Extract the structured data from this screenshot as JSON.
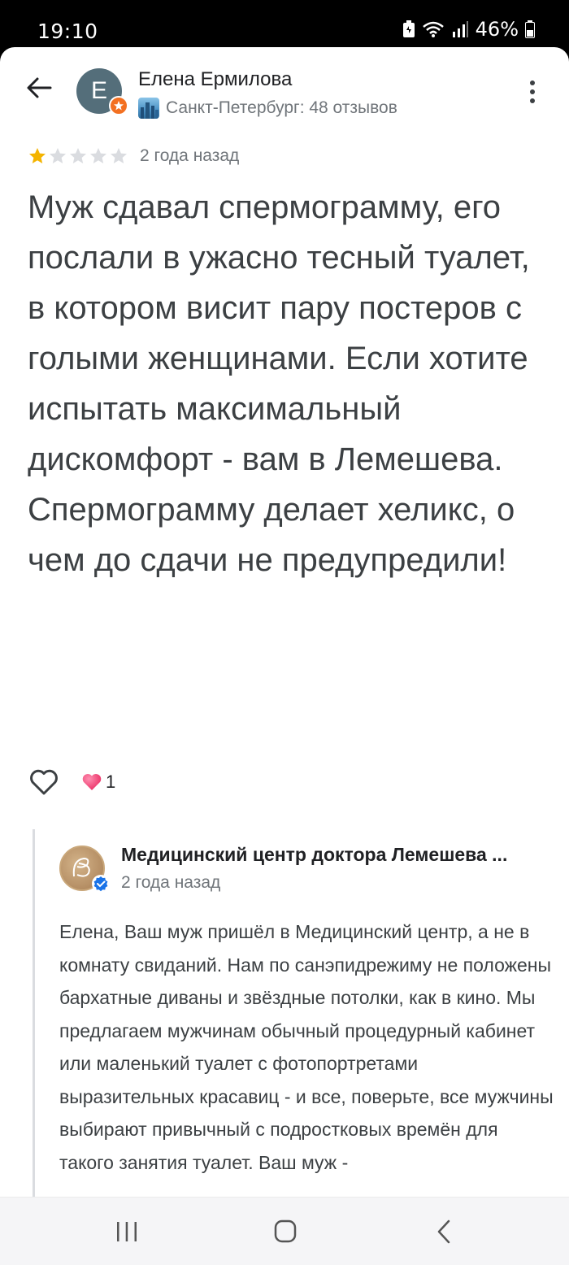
{
  "status_bar": {
    "time": "19:10",
    "battery": "46%"
  },
  "header": {
    "author_name": "Елена Ермилова",
    "avatar_letter": "E",
    "author_meta": "Санкт-Петербург: 48 отзывов"
  },
  "review": {
    "rating": 1,
    "max_rating": 5,
    "date": "2 года назад",
    "text": "Муж сдавал спермограмму, его послали в ужасно тесный туалет, в котором висит пару постеров с голыми женщинами. Если хотите испытать максимальный дискомфорт - вам в Лемешева.\nСпермограмму делает хеликс, о чем до сдачи не предупредили!",
    "reaction_count": "1"
  },
  "reply": {
    "owner_name": "Медицинский центр доктора Лемешева ...",
    "date": "2 года назад",
    "text": "Елена, Ваш муж пришёл в Медицинский центр, а не в комнату свиданий. Нам по санэпидрежиму не положены бархатные диваны и звёздные потолки, как в кино. Мы предлагаем мужчинам обычный процедурный кабинет или маленький туалет с фотопортретами  выразительных красавиц - и все, поверьте, все мужчины выбирают привычный с подростковых времён для такого занятия туалет. Ваш муж -"
  },
  "colors": {
    "star_filled": "#f4b400",
    "star_empty": "#dadce0",
    "verified": "#1a73e8",
    "badge": "#f37021"
  },
  "icons": [
    "back-arrow-icon",
    "more-vert-icon",
    "heart-outline-icon",
    "heart-filled-icon",
    "verified-icon",
    "local-guide-badge-icon",
    "recents-icon",
    "home-icon",
    "back-nav-icon"
  ]
}
